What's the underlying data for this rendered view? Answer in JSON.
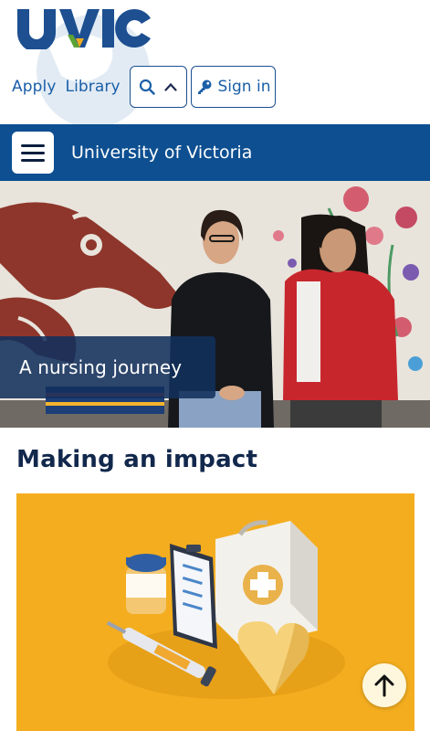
{
  "brand": {
    "logo_text": "UVIC",
    "colors": {
      "blue": "#1d4f91",
      "gold": "#f0ac1e",
      "green": "#5ca336"
    }
  },
  "utility_nav": {
    "apply_label": "Apply",
    "library_label": "Library",
    "search_icon": "search-icon",
    "toggle_icon": "chevron-up-icon",
    "signin_icon": "key-icon",
    "signin_label": "Sign in"
  },
  "site_bar": {
    "menu_icon": "hamburger-icon",
    "title": "University of Victoria",
    "background": "#0d4f91"
  },
  "hero": {
    "caption": "A nursing journey"
  },
  "main": {
    "section_title": "Making an impact",
    "card_background": "#f3ad1f"
  },
  "back_to_top": {
    "icon": "arrow-up-icon"
  }
}
